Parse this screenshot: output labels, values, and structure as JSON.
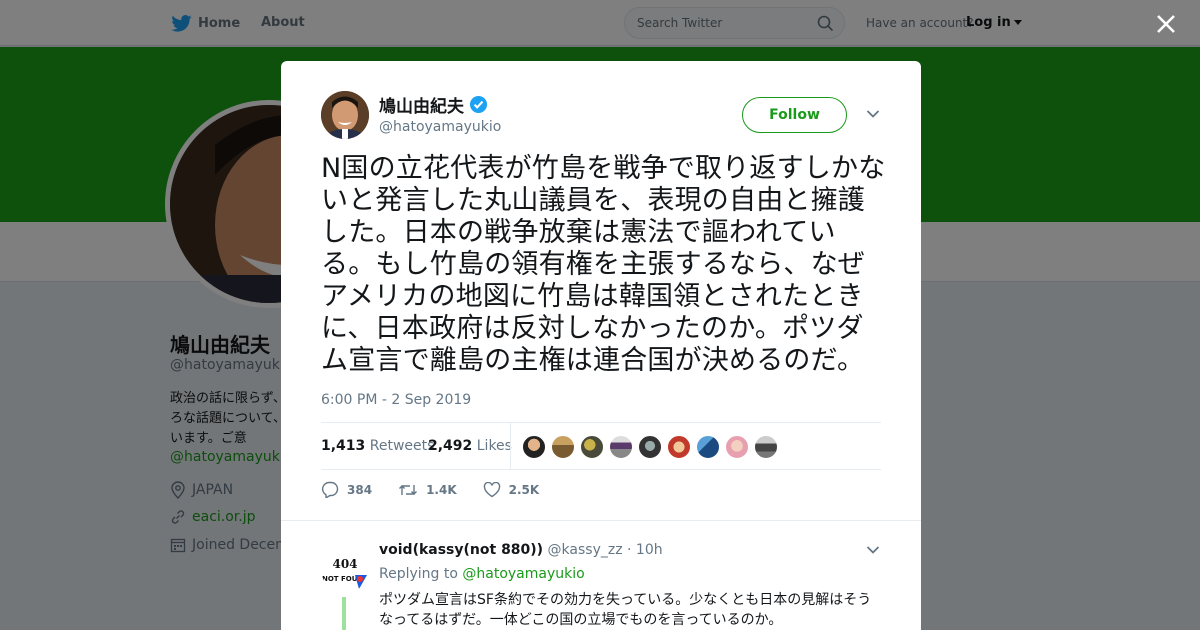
{
  "nav": {
    "home_label": "Home",
    "about_label": "About",
    "search_placeholder": "Search Twitter",
    "account_question": "Have an account?",
    "login_label": "Log in"
  },
  "colors": {
    "brand": "#1da1f2",
    "profile_link": "#1a9a1a",
    "banner": "#1aa21a"
  },
  "profile": {
    "name": "鳩山由紀夫",
    "handle": "@hatoyamayukio",
    "bio": "政治の話に限らず、いろいろな話題について、語っています。ご意",
    "bio_link": "@hatoyamayukio",
    "location": "JAPAN",
    "website": "eaci.or.jp",
    "joined": "Joined Decem"
  },
  "tweet": {
    "author_name": "鳩山由紀夫",
    "author_handle": "@hatoyamayukio",
    "follow_label": "Follow",
    "text": "N国の立花代表が竹島を戦争で取り返すしかないと発言した丸山議員を、表現の自由と擁護した。日本の戦争放棄は憲法で謳われている。もし竹島の領有権を主張するなら、なぜアメリカの地図に竹島は韓国領とされたときに、日本政府は反対しなかったのか。ポツダム宣言で離島の主権は連合国が決めるのだ。",
    "timestamp": "6:00 PM - 2 Sep 2019",
    "retweets_count": "1,413",
    "retweets_label": "Retweets",
    "likes_count": "2,492",
    "likes_label": "Likes",
    "reply_action_count": "384",
    "retweet_action_count": "1.4K",
    "like_action_count": "2.5K"
  },
  "reply": {
    "name": "void(kassy(not 880))",
    "handle": "@kassy_zz",
    "time": "· 10h",
    "replying_label": "Replying to",
    "replying_to": "@hatoyamayukio",
    "avatar_text_top": "404",
    "avatar_text_bottom": "NOT FOU",
    "text": "ポツダム宣言はSF条約でその効力を失っている。少なくとも日本の見解はそうなってるはずだ。一体どこの国の立場でものを言っているのか。"
  }
}
